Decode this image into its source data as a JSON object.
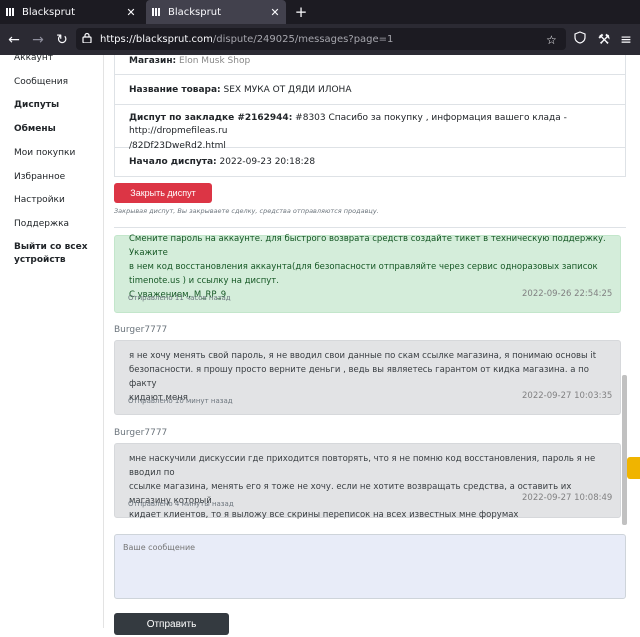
{
  "browser": {
    "tabs": [
      {
        "title": "Blacksprut",
        "active": false
      },
      {
        "title": "Blacksprut",
        "active": true
      }
    ],
    "url_host": "https://blacksprut.com",
    "url_path": "/dispute/249025/messages?page=1"
  },
  "sidebar": {
    "items": [
      {
        "label": "Аккаунт",
        "bold": false
      },
      {
        "label": "Сообщения",
        "bold": false
      },
      {
        "label": "Диспуты",
        "bold": true
      },
      {
        "label": "Обмены",
        "bold": true
      },
      {
        "label": "Мои покупки",
        "bold": false
      },
      {
        "label": "Избранное",
        "bold": false
      },
      {
        "label": "Настройки",
        "bold": false
      },
      {
        "label": "Поддержка",
        "bold": false
      },
      {
        "label": "Выйти со всех устройств",
        "bold": true
      }
    ]
  },
  "dispute": {
    "shop_label": "Магазин:",
    "shop_value": "Elon Musk Shop",
    "product_label": "Название товара:",
    "product_value": "SEX МУКА ОТ ДЯДИ ИЛОНА",
    "bookmark_label": "Диспут по закладке #2162944:",
    "bookmark_value_1": "#8303 Спасибо за покупку , информация вашего клада - http://dropmefileas.ru",
    "bookmark_value_2": "/82Df23DweRd2.html",
    "start_label": "Начало диспута:",
    "start_value": "2022-09-23 20:18:28",
    "close_button": "Закрыть диспут",
    "close_note": "Закрывая диспут, Вы закрываете сделку, средства отправляются продавцу."
  },
  "messages": [
    {
      "author": "",
      "lines": [
        "Смените пароль на аккаунте. для быстрого возврата средств создайте тикет в техническую поддержку. Укажите",
        "в нем код восстановления аккаунта(для безопасности отправляйте через сервис одноразовых записок",
        "timenote.us ) и ссылку на диспут.",
        "С уважением, M_RP_9"
      ],
      "sent": "Отправлено 11 часов назад",
      "time": "2022-09-26 22:54:25",
      "style": "green"
    },
    {
      "author": "Burger7777",
      "lines": [
        "я не хочу менять свой пароль, я не вводил свои данные по скам ссылке магазина, я понимаю основы it",
        "безопасности. я прошу просто верните деньги , ведь вы являетесь гарантом от кидка магазина. а по факту",
        "кидают меня"
      ],
      "sent": "Отправлено 10 минут назад",
      "time": "2022-09-27 10:03:35",
      "style": "grey"
    },
    {
      "author": "Burger7777",
      "lines": [
        "мне наскучили дискуссии где приходится повторять, что я не помню код восстановления, пароль я не вводил по",
        "ссылке магазина, менять его я тоже не хочу. если не хотите возвращать средства, а оставить их магазину который",
        "кидает клиентов, то я выложу все скрины переписок на всех известных мне форумах"
      ],
      "sent": "Отправлено 4 минуты назад",
      "time": "2022-09-27 10:08:49",
      "style": "grey"
    }
  ],
  "composer": {
    "placeholder": "Ваше сообщение",
    "submit": "Отправить"
  }
}
